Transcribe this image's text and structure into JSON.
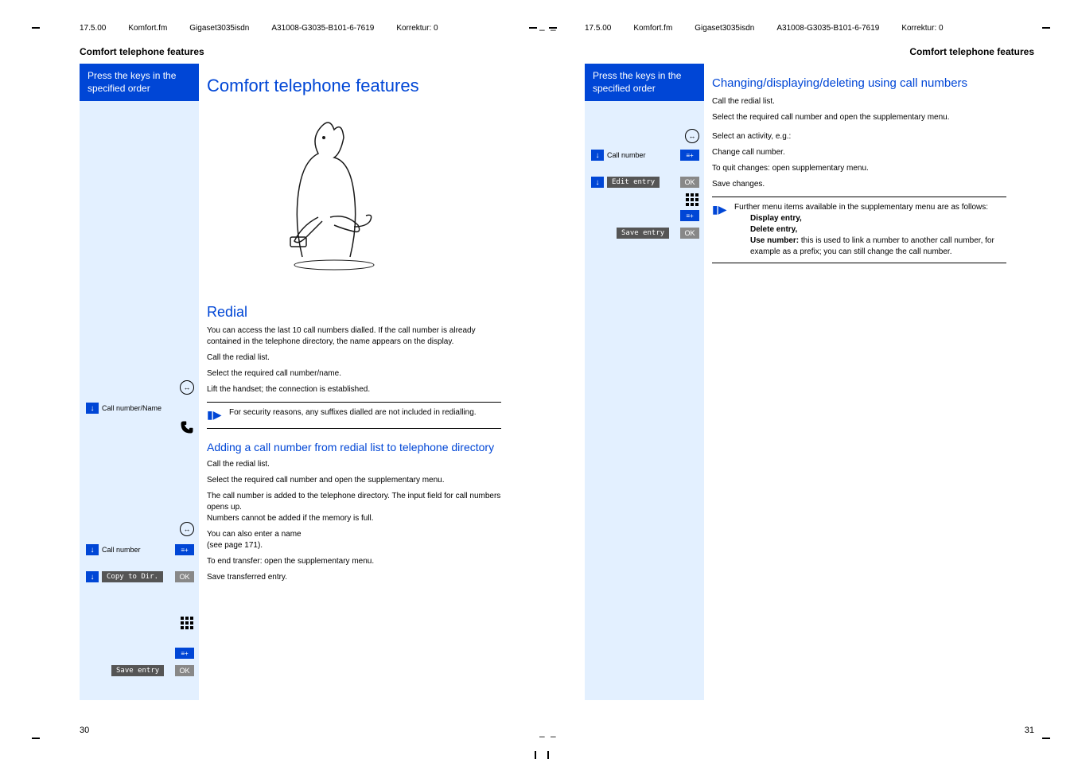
{
  "meta": {
    "date": "17.5.00",
    "file": "Komfort.fm",
    "product": "Gigaset3035isdn",
    "code": "A31008-G3035-B101-6-7619",
    "correction": "Korrektur: 0"
  },
  "section_title": "Comfort telephone features",
  "press_keys": "Press the keys in the specified order",
  "left": {
    "h1": "Comfort telephone features",
    "redial": {
      "title": "Redial",
      "intro": "You can access the last 10 call numbers dialled. If the call number is already contained in the telephone directory, the name appears on the display.",
      "step1": "Call the redial list.",
      "step2_label": "Call number/Name",
      "step2": "Select the required call number/name.",
      "step3": "Lift the handset; the connection is established.",
      "note": "For security reasons, any suffixes dialled are not included in redialling."
    },
    "adding": {
      "title": "Adding a call number from redial list to telephone directory",
      "step1": "Call the redial list.",
      "step2_label": "Call number",
      "step2": "Select the required call number and open the supplementary menu.",
      "step3_label": "Copy to Dir.",
      "step3": "The call number is added to the telephone directory. The input field for call numbers opens up.\nNumbers cannot be added if the memory is full.",
      "step4": "You can also enter a name\n(see page 171).",
      "step5": "To end transfer: open the supplementary menu.",
      "step6_label": "Save entry",
      "step6": "Save transferred entry."
    },
    "page_num": "30"
  },
  "right": {
    "changing": {
      "title": "Changing/displaying/deleting using call numbers",
      "step1": "Call the redial list.",
      "step2_label": "Call number",
      "step2": "Select the required call number and open the supplementary menu.",
      "step3_label": "Edit entry",
      "step3": "Select an activity, e.g.:",
      "step4": "Change call number.",
      "step5": "To quit changes: open supplementary menu.",
      "step6_label": "Save entry",
      "step6": "Save changes.",
      "note_intro": "Further menu items available in the supplementary menu are as follows:",
      "note_display": "Display entry,",
      "note_delete": "Delete entry,",
      "note_use_bold": "Use number:",
      "note_use": " this is used to link a number to another call number, for example as a prefix; you can still change the call number."
    },
    "page_num": "31"
  },
  "ok_label": "OK"
}
